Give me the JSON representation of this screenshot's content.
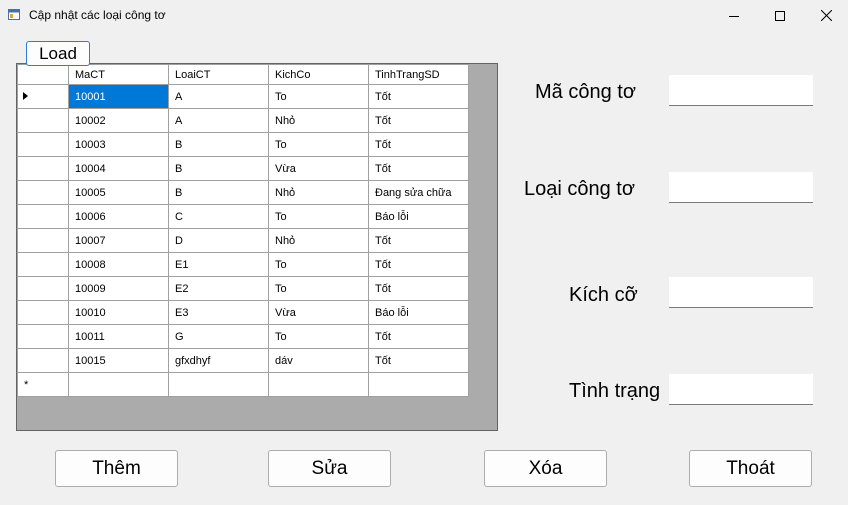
{
  "window": {
    "title": "Cập nhật các loại công tơ"
  },
  "load_button": "Load",
  "grid": {
    "columns": [
      "MaCT",
      "LoaiCT",
      "KichCo",
      "TinhTrangSD"
    ],
    "rows": [
      [
        "10001",
        "A",
        "To",
        "Tốt"
      ],
      [
        "10002",
        "A",
        "Nhỏ",
        "Tốt"
      ],
      [
        "10003",
        "B",
        "To",
        "Tốt"
      ],
      [
        "10004",
        "B",
        "Vừa",
        "Tốt"
      ],
      [
        "10005",
        "B",
        "Nhỏ",
        "Đang sửa chữa"
      ],
      [
        "10006",
        "C",
        "To",
        "Báo lỗi"
      ],
      [
        "10007",
        "D",
        "Nhỏ",
        "Tốt"
      ],
      [
        "10008",
        "E1",
        "To",
        "Tốt"
      ],
      [
        "10009",
        "E2",
        "To",
        "Tốt"
      ],
      [
        "10010",
        "E3",
        "Vừa",
        "Báo lỗi"
      ],
      [
        "10011",
        "G",
        "To",
        "Tốt"
      ],
      [
        "10015",
        "gfxdhyf",
        "dáv",
        "Tốt"
      ]
    ],
    "new_row_marker": "*"
  },
  "form": {
    "ma_label": "Mã công tơ",
    "loai_label": "Loại công tơ",
    "kich_label": "Kích cỡ",
    "tinh_label": "Tình trạng",
    "ma_value": "",
    "loai_value": "",
    "kich_value": "",
    "tinh_value": ""
  },
  "buttons": {
    "them": "Thêm",
    "sua": "Sửa",
    "xoa": "Xóa",
    "thoat": "Thoát"
  },
  "colors": {
    "selection": "#0078d7",
    "grid_background": "#ababab",
    "load_border": "#2c7cd6"
  }
}
